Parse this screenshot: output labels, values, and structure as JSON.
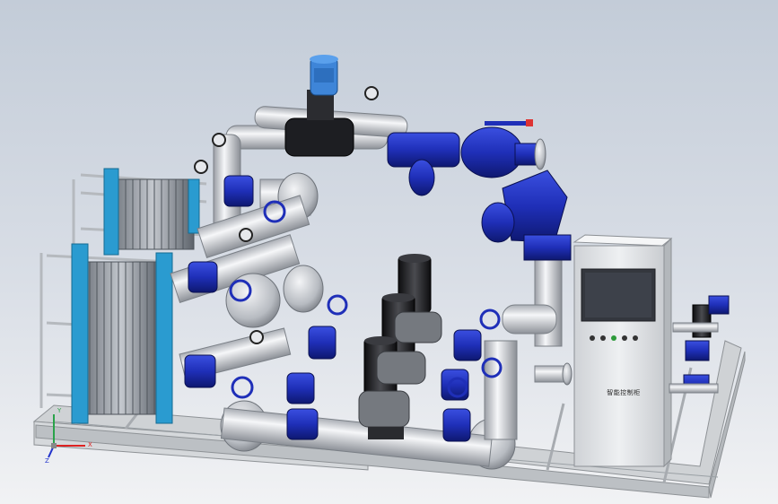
{
  "model": {
    "panel_label": "智能控制柜",
    "axis_labels": {
      "x": "X",
      "y": "Y",
      "z": "Z"
    }
  },
  "colors": {
    "background_top": "#c3ccd8",
    "background_bottom": "#f1f2f4",
    "pipe": "#e6e8ec",
    "valve_blue": "#1f2fb8",
    "heat_exchanger_frame": "#2a9bd0",
    "motor_black": "#1d1d1f",
    "control_cabinet": "#e4e6e8",
    "screen": "#3a3d45",
    "skid_frame": "#d0d3d6"
  }
}
